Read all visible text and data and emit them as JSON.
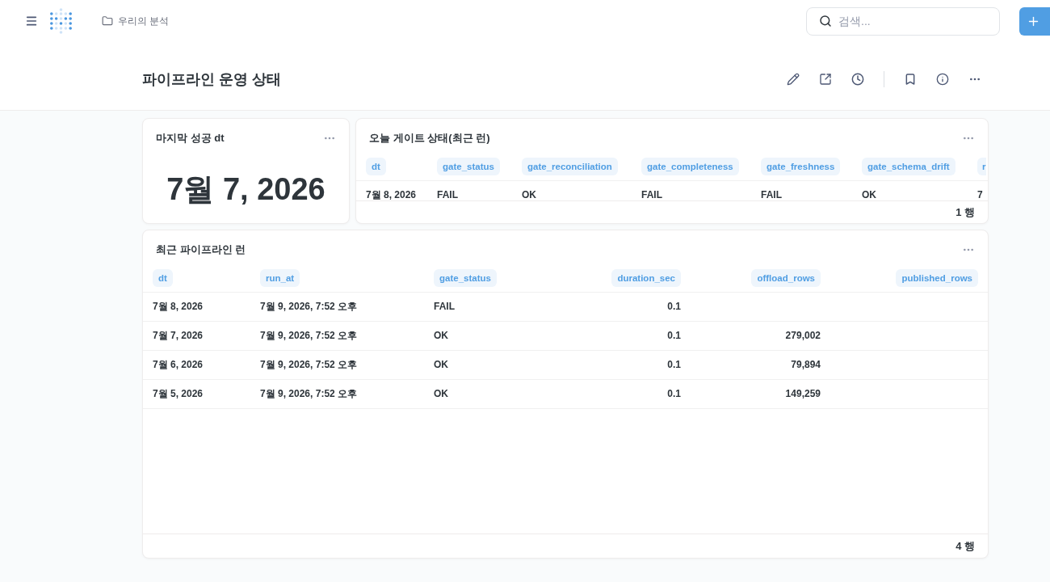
{
  "nav": {
    "breadcrumb": "우리의 분석",
    "search": {
      "placeholder": "검색..."
    }
  },
  "dashboard": {
    "title": "파이프라인 운영 상태"
  },
  "cards": [
    {
      "kind": "scalar",
      "title": "마지막 성공 dt",
      "value": "7월 7, 2026"
    },
    {
      "kind": "table",
      "title": "오늘 게이트 상태(최근 런)",
      "columns": [
        {
          "label": "dt"
        },
        {
          "label": "gate_status"
        },
        {
          "label": "gate_reconciliation"
        },
        {
          "label": "gate_completeness"
        },
        {
          "label": "gate_freshness"
        },
        {
          "label": "gate_schema_drift"
        },
        {
          "label": "r"
        }
      ],
      "rows": [
        [
          "7월 8, 2026",
          "FAIL",
          "OK",
          "FAIL",
          "FAIL",
          "OK",
          "7"
        ]
      ],
      "footer": "1 행"
    },
    {
      "kind": "table",
      "title": "최근 파이프라인 런",
      "columns": [
        {
          "label": "dt"
        },
        {
          "label": "run_at"
        },
        {
          "label": "gate_status"
        },
        {
          "label": "duration_sec",
          "numeric": true
        },
        {
          "label": "offload_rows",
          "numeric": true
        },
        {
          "label": "published_rows",
          "numeric": true
        }
      ],
      "rows": [
        [
          "7월 8, 2026",
          "7월 9, 2026, 7:52 오후",
          "FAIL",
          "0.1"
        ],
        [
          "7월 7, 2026",
          "7월 9, 2026, 7:52 오후",
          "OK",
          "0.1",
          "279,002"
        ],
        [
          "7월 6, 2026",
          "7월 9, 2026, 7:52 오후",
          "OK",
          "0.1",
          "79,894"
        ],
        [
          "7월 5, 2026",
          "7월 9, 2026, 7:52 오후",
          "OK",
          "0.1",
          "149,259"
        ]
      ],
      "footer": "4 행"
    }
  ]
}
